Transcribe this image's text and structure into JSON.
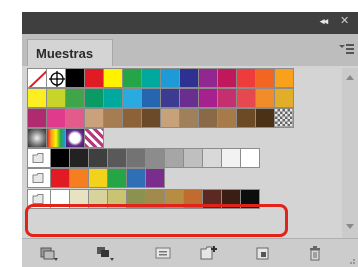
{
  "panel": {
    "tab_label": "Muestras",
    "collapse_glyph": "◂◂",
    "close_glyph": "✕"
  },
  "swatch_rows": [
    [
      "none",
      "registration",
      "#000000",
      "#e01b23",
      "#fff200",
      "#26a547",
      "#00a99d",
      "#1e9ad7",
      "#2e3192",
      "#92278f",
      "#c0185b",
      "#ee3b3c",
      "#f26522",
      "#f9a11b"
    ],
    [
      "#fcee21",
      "#c8d42a",
      "#3ea548",
      "#0a9a64",
      "#00a99d",
      "#29abe2",
      "#2666b1",
      "#3d3a91",
      "#6a2d90",
      "#a6218d",
      "#c42f6e",
      "#e5494f",
      "#f28c28",
      "#e2ae2a"
    ],
    [
      "#b02a70",
      "#e03a8d",
      "#e35b8a",
      "#c9a17a",
      "#a67c52",
      "#8c6239",
      "#6b4a2a",
      "#c7a17a",
      "#a0805a",
      "#8a6a46",
      "#a77a4a",
      "#6d4a26",
      "#4b3116",
      "pattern-checker"
    ],
    [
      "pattern-sphere",
      "gradient-rainbow",
      "pattern-white-circle",
      "pattern-stripes"
    ],
    [
      "#000000",
      "#222222",
      "#3f3f3f",
      "#595959",
      "#737373",
      "#8c8c8c",
      "#a6a6a6",
      "#bfbfbf",
      "#d9d9d9",
      "#f2f2f2",
      "#ffffff"
    ],
    [
      "#e01b23",
      "#f57f20",
      "#f2d21b",
      "#26a547",
      "#2e6fb6",
      "#7a2d8c"
    ],
    [
      "#ffffff",
      "#e6e2c2",
      "#d8d39d",
      "#c9c372",
      "#8b9250",
      "#a28a4c",
      "#b68d43",
      "#bf6c2e",
      "#5b2822",
      "#3a1e14",
      "#0d0d0d"
    ]
  ],
  "highlight_color": "#e2231a",
  "bottom_icons": [
    "swatch-libraries-icon",
    "show-swatch-kinds-icon",
    "swatch-options-icon",
    "new-color-group-icon",
    "new-swatch-icon",
    "delete-swatch-icon"
  ]
}
